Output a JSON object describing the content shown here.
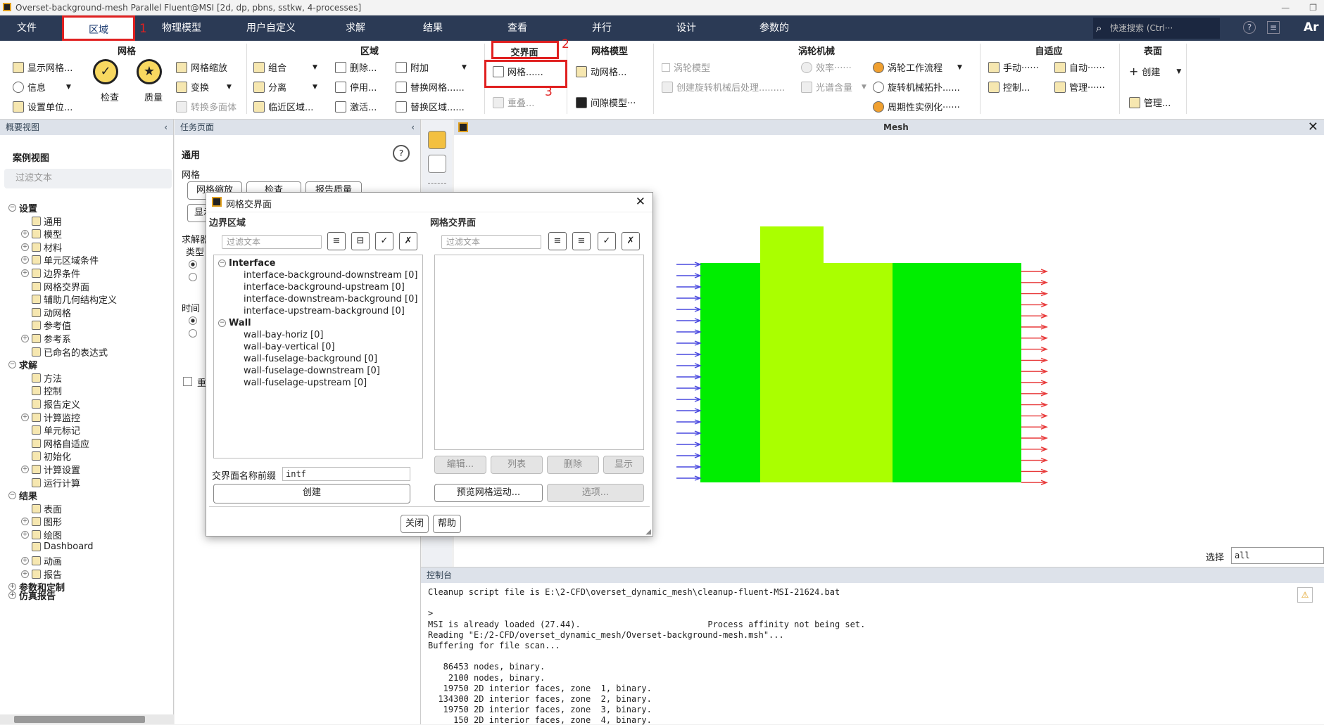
{
  "titlebar": {
    "title": "Overset-background-mesh Parallel Fluent@MSI  [2d, dp, pbns, sstkw, 4-processes]"
  },
  "menu": {
    "items": [
      "文件",
      "区域",
      "物理模型",
      "用户自定义",
      "求解",
      "结果",
      "查看",
      "并行",
      "设计",
      "参数的"
    ],
    "search_placeholder": "快速搜索 (Ctrl···",
    "brand": "Ar"
  },
  "annotations": {
    "n1": "1",
    "n2": "2",
    "n3": "3"
  },
  "ribbon": {
    "mesh": {
      "title": "网格",
      "display": "显示网格...",
      "info": "信息",
      "units": "设置单位...",
      "check": "检查",
      "quality": "质量",
      "scale": "网格缩放",
      "transform": "变换",
      "polyhedra": "转换多面体"
    },
    "zones": {
      "title": "区域",
      "combine": "组合",
      "separate": "分离",
      "adjacency": "临近区域...",
      "delete": "删除...",
      "deactivate": "停用...",
      "activate": "激活...",
      "append": "附加",
      "replace_mesh": "替换网格......",
      "replace_zone": "替换区域......"
    },
    "interfaces": {
      "title": "交界面",
      "mesh": "网格......",
      "overlap": "重叠..."
    },
    "mesh_models": {
      "title": "网格模型",
      "dynamic": "动网格...",
      "gap": "间隙模型···"
    },
    "turbo": {
      "title": "涡轮机械",
      "model": "涡轮模型",
      "post": "创建旋转机械后处理.........",
      "efficiency": "效率······",
      "spectral": "光谱含量",
      "workflow": "涡轮工作流程",
      "topology": "旋转机械拓扑......",
      "periodic": "周期性实例化······"
    },
    "adapt": {
      "title": "自适应",
      "manual": "手动······",
      "automatic": "自动······",
      "control": "控制...",
      "manage": "管理······"
    },
    "surface": {
      "title": "表面",
      "create": "创建",
      "manage": "管理..."
    }
  },
  "outline": {
    "title": "概要视图",
    "case_view": "案例视图",
    "filter_placeholder": "过滤文本",
    "setup": "设置",
    "general": "通用",
    "models": "模型",
    "materials": "材料",
    "cell_zones": "单元区域条件",
    "boundary": "边界条件",
    "mesh_interfaces": "网格交界面",
    "aux_geom": "辅助几何结构定义",
    "dynamic_mesh": "动网格",
    "ref_values": "参考值",
    "ref_frames": "参考系",
    "named_expr": "已命名的表达式",
    "solution": "求解",
    "methods": "方法",
    "controls": "控制",
    "report_defs": "报告定义",
    "monitors": "计算监控",
    "cell_marks": "单元标记",
    "adaption": "网格自适应",
    "init": "初始化",
    "calc_act": "计算设置",
    "run": "运行计算",
    "results": "结果",
    "surfaces": "表面",
    "graphics": "图形",
    "plots": "绘图",
    "dashboard": "Dashboard",
    "animations": "动画",
    "reports": "报告",
    "params": "参数和定制",
    "sim_report": "仿真报告"
  },
  "task": {
    "title": "任务页面",
    "general": "通用",
    "mesh": "网格",
    "scale_btn": "网格缩放",
    "check_btn": "检查",
    "quality_btn": "报告质量",
    "display_btn": "显示",
    "solver": "求解器",
    "type": "类型",
    "time": "时间",
    "gravity": "重"
  },
  "graphics": {
    "title": "Mesh",
    "select_label": "选择",
    "select_value": "all"
  },
  "console": {
    "title": "控制台",
    "lines": [
      "Cleanup script file is E:\\2-CFD\\overset_dynamic_mesh\\cleanup-fluent-MSI-21624.bat",
      "",
      ">",
      "MSI is already loaded (27.44).                         Process affinity not being set.",
      "Reading \"E:/2-CFD/overset_dynamic_mesh/Overset-background-mesh.msh\"...",
      "Buffering for file scan...",
      "",
      "   86453 nodes, binary.",
      "    2100 nodes, binary.",
      "   19750 2D interior faces, zone  1, binary.",
      "  134300 2D interior faces, zone  2, binary.",
      "   19750 2D interior faces, zone  3, binary.",
      "     150 2D interior faces, zone  4, binary."
    ]
  },
  "dialog": {
    "title": "网格交界面",
    "boundary_zones": "边界区域",
    "mesh_interfaces": "网格交界面",
    "filter_placeholder": "过滤文本",
    "group_interface": "Interface",
    "group_wall": "Wall",
    "interface_items": [
      "interface-background-downstream  [0]",
      "interface-background-upstream  [0]",
      "interface-downstream-background  [0]",
      "interface-upstream-background  [0]"
    ],
    "wall_items": [
      "wall-bay-horiz  [0]",
      "wall-bay-vertical  [0]",
      "wall-fuselage-background  [0]",
      "wall-fuselage-downstream  [0]",
      "wall-fuselage-upstream  [0]"
    ],
    "prefix_label": "交界面名称前缀",
    "prefix_value": "intf",
    "create": "创建",
    "edit": "编辑...",
    "list": "列表",
    "delete": "删除",
    "display": "显示",
    "preview": "预览网格运动...",
    "options": "选项...",
    "close": "关闭",
    "help": "帮助"
  },
  "colors": {
    "menubar": "#2b3a55",
    "highlight": "#e02020",
    "mesh_green": "#00ee00",
    "mesh_yellow": "#aaff00",
    "arrow_blue": "#4a4adf",
    "arrow_red": "#e83a3a"
  }
}
